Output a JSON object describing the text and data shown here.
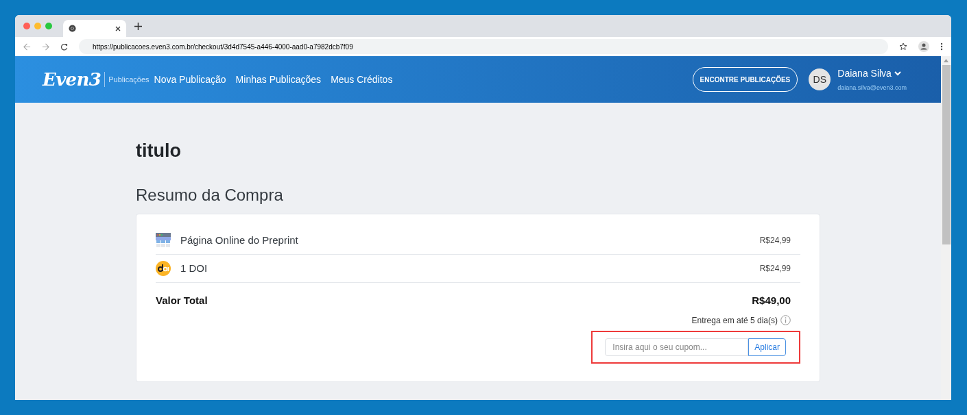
{
  "browser": {
    "url": "https://publicacoes.even3.com.br/checkout/3d4d7545-a446-4000-aad0-a7982dcb7f09"
  },
  "header": {
    "logo": "Even3",
    "section": "Publicações",
    "nav": [
      "Nova Publicação",
      "Minhas Publicações",
      "Meus Créditos"
    ],
    "cta": "ENCONTRE PUBLICAÇÕES",
    "user": {
      "initials": "DS",
      "name": "Daiana Silva",
      "email": "daiana.silva@even3.com"
    }
  },
  "page": {
    "title": "titulo",
    "subtitle": "Resumo da Compra"
  },
  "summary": {
    "items": [
      {
        "kind": "webpage",
        "name": "Página Online do Preprint",
        "price": "R$24,99"
      },
      {
        "kind": "doi",
        "name": "1 DOI",
        "price": "R$24,99"
      }
    ],
    "total_label": "Valor Total",
    "total_value": "R$49,00",
    "delivery": "Entrega em até 5 dia(s)",
    "coupon": {
      "placeholder": "Insira aqui o seu cupom...",
      "button": "Aplicar",
      "highlighted": true
    }
  }
}
